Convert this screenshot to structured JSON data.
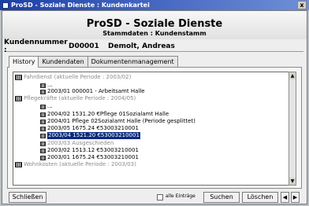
{
  "window": {
    "title": "ProSD - Soziale Dienste : Kundenkartei",
    "close_label": "x"
  },
  "header": {
    "title": "ProSD - Soziale Dienste",
    "subtitle": "Stammdaten : Kundenstamm"
  },
  "customer": {
    "label": "Kundennummer :",
    "number": "D00001",
    "name": "Demolt, Andreas"
  },
  "tabs": [
    {
      "label": "History"
    },
    {
      "label": "Kundendaten"
    },
    {
      "label": "Dokumentenmanagement"
    }
  ],
  "tree": {
    "groups": {
      "fahrdienst": "Fahrdienst (aktuelle Periode : 2003/02)",
      "pflege": "Pflegekräfte (aktuelle Periode : 2004/05)",
      "wohnkosten": "Wohnkosten (aktuelle Periode : 2003/03)"
    },
    "items": {
      "fd1": "...",
      "fd2": "2003/01 000001 - Arbeitsamt Halle",
      "pf1": "...",
      "pf2": "2004/02 1531.20 €Pflege 01Sozialamt Halle",
      "pf3": "2004/01 Pflege 02Sozialamt Halle (Periode gesplittet)",
      "pf4": "2003/05 1675.24 €53003210001",
      "pf5": "2003/04 1521.20 €53003210001",
      "pf6": "2003/03 Ausgeschieden",
      "pf7": "2003/02 1513.12 €53003210001",
      "pf8": "2003/01 1675.24 €53003210001"
    }
  },
  "footer": {
    "close_button": "Schließen",
    "all_entries_label": "alle Einträge",
    "search_button": "Suchen",
    "delete_button": "Löschen",
    "prev_label": "◀",
    "next_label": "▶"
  }
}
